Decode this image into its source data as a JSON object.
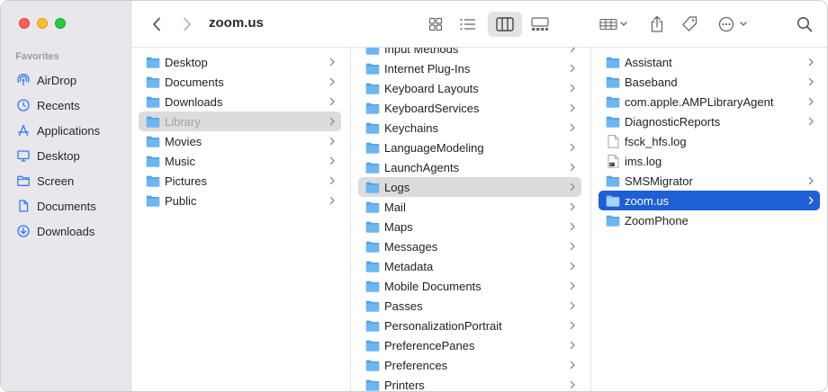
{
  "window": {
    "title": "zoom.us"
  },
  "sidebar": {
    "section_title": "Favorites",
    "items": [
      {
        "label": "AirDrop",
        "icon": "airdrop-icon"
      },
      {
        "label": "Recents",
        "icon": "clock-icon"
      },
      {
        "label": "Applications",
        "icon": "applications-icon"
      },
      {
        "label": "Desktop",
        "icon": "desktop-icon"
      },
      {
        "label": "Screen",
        "icon": "folder-icon"
      },
      {
        "label": "Documents",
        "icon": "document-icon"
      },
      {
        "label": "Downloads",
        "icon": "download-icon"
      }
    ]
  },
  "toolbar": {
    "back": "chevron-left-icon",
    "forward": "chevron-right-icon",
    "views": [
      "icon-view",
      "list-view",
      "column-view",
      "gallery-view"
    ],
    "active_view": "column-view",
    "actions": [
      "group-icon",
      "share-icon",
      "tag-icon",
      "more-icon",
      "search-icon"
    ]
  },
  "column1": {
    "items": [
      {
        "label": "Desktop",
        "has_children": true
      },
      {
        "label": "Documents",
        "has_children": true
      },
      {
        "label": "Downloads",
        "has_children": true
      },
      {
        "label": "Library",
        "has_children": true,
        "selected": "inactive"
      },
      {
        "label": "Movies",
        "has_children": true
      },
      {
        "label": "Music",
        "has_children": true
      },
      {
        "label": "Pictures",
        "has_children": true
      },
      {
        "label": "Public",
        "has_children": true
      }
    ]
  },
  "column2": {
    "items": [
      {
        "label": "Input Methods",
        "has_children": true
      },
      {
        "label": "Internet Plug-Ins",
        "has_children": true
      },
      {
        "label": "Keyboard Layouts",
        "has_children": true
      },
      {
        "label": "KeyboardServices",
        "has_children": true
      },
      {
        "label": "Keychains",
        "has_children": true
      },
      {
        "label": "LanguageModeling",
        "has_children": true
      },
      {
        "label": "LaunchAgents",
        "has_children": true
      },
      {
        "label": "Logs",
        "has_children": true,
        "selected": "inactive"
      },
      {
        "label": "Mail",
        "has_children": true
      },
      {
        "label": "Maps",
        "has_children": true
      },
      {
        "label": "Messages",
        "has_children": true
      },
      {
        "label": "Metadata",
        "has_children": true
      },
      {
        "label": "Mobile Documents",
        "has_children": true
      },
      {
        "label": "Passes",
        "has_children": true
      },
      {
        "label": "PersonalizationPortrait",
        "has_children": true
      },
      {
        "label": "PreferencePanes",
        "has_children": true
      },
      {
        "label": "Preferences",
        "has_children": true
      },
      {
        "label": "Printers",
        "has_children": true
      }
    ]
  },
  "column3": {
    "items": [
      {
        "label": "Assistant",
        "has_children": true,
        "kind": "folder"
      },
      {
        "label": "Baseband",
        "has_children": true,
        "kind": "folder"
      },
      {
        "label": "com.apple.AMPLibraryAgent",
        "has_children": true,
        "kind": "folder"
      },
      {
        "label": "DiagnosticReports",
        "has_children": true,
        "kind": "folder"
      },
      {
        "label": "fsck_hfs.log",
        "has_children": false,
        "kind": "file"
      },
      {
        "label": "ims.log",
        "has_children": false,
        "kind": "log"
      },
      {
        "label": "SMSMigrator",
        "has_children": true,
        "kind": "folder"
      },
      {
        "label": "zoom.us",
        "has_children": true,
        "kind": "folder",
        "selected": "active"
      },
      {
        "label": "ZoomPhone",
        "has_children": false,
        "kind": "folder"
      }
    ]
  },
  "colors": {
    "folder": "#6cb6f2",
    "selection_active": "#1e5fd6",
    "selection_inactive": "#dcdcdc",
    "sidebar_icon": "#2f7bf5"
  }
}
